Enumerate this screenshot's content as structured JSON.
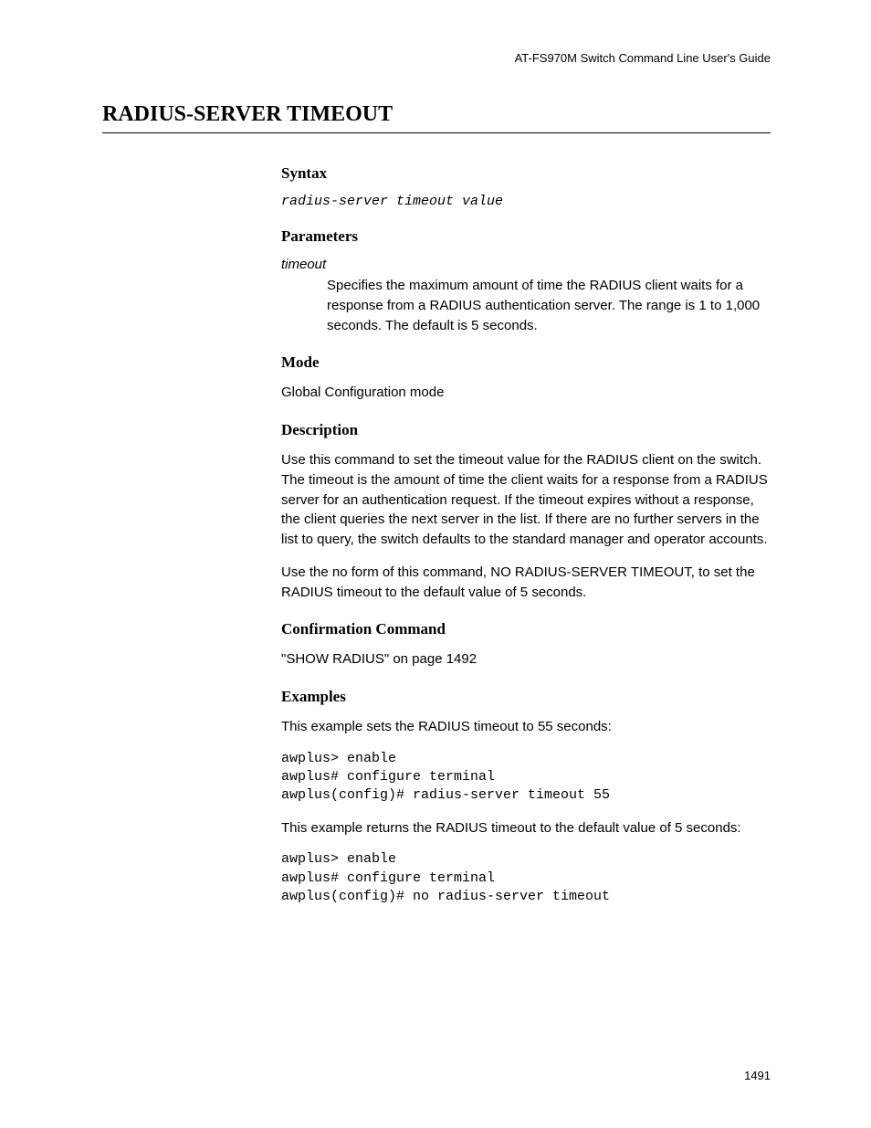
{
  "header": "AT-FS970M Switch Command Line User's Guide",
  "title": "RADIUS-SERVER TIMEOUT",
  "sections": {
    "syntax": {
      "heading": "Syntax",
      "text": "radius-server timeout value"
    },
    "parameters": {
      "heading": "Parameters",
      "param_name": "timeout",
      "param_desc": "Specifies the maximum amount of time the RADIUS client waits for a response from a RADIUS authentication server. The range is 1 to 1,000 seconds. The default is 5 seconds."
    },
    "mode": {
      "heading": "Mode",
      "text": "Global Configuration mode"
    },
    "description": {
      "heading": "Description",
      "para1": "Use this command to set the timeout value for the RADIUS client on the switch. The timeout is the amount of time the client waits for a response from a RADIUS server for an authentication request. If the timeout expires without a response, the client queries the next server in the list. If there are no further servers in the list to query, the switch defaults to the standard manager and operator accounts.",
      "para2": "Use the no form of this command, NO RADIUS-SERVER TIMEOUT, to set the RADIUS timeout to the default value of 5 seconds."
    },
    "confirmation": {
      "heading": "Confirmation Command",
      "text": "\"SHOW RADIUS\" on page 1492"
    },
    "examples": {
      "heading": "Examples",
      "intro1": "This example sets the RADIUS timeout to 55 seconds:",
      "code1": "awplus> enable\nawplus# configure terminal\nawplus(config)# radius-server timeout 55",
      "intro2": "This example returns the RADIUS timeout to the default value of 5 seconds:",
      "code2": "awplus> enable\nawplus# configure terminal\nawplus(config)# no radius-server timeout"
    }
  },
  "page_number": "1491"
}
